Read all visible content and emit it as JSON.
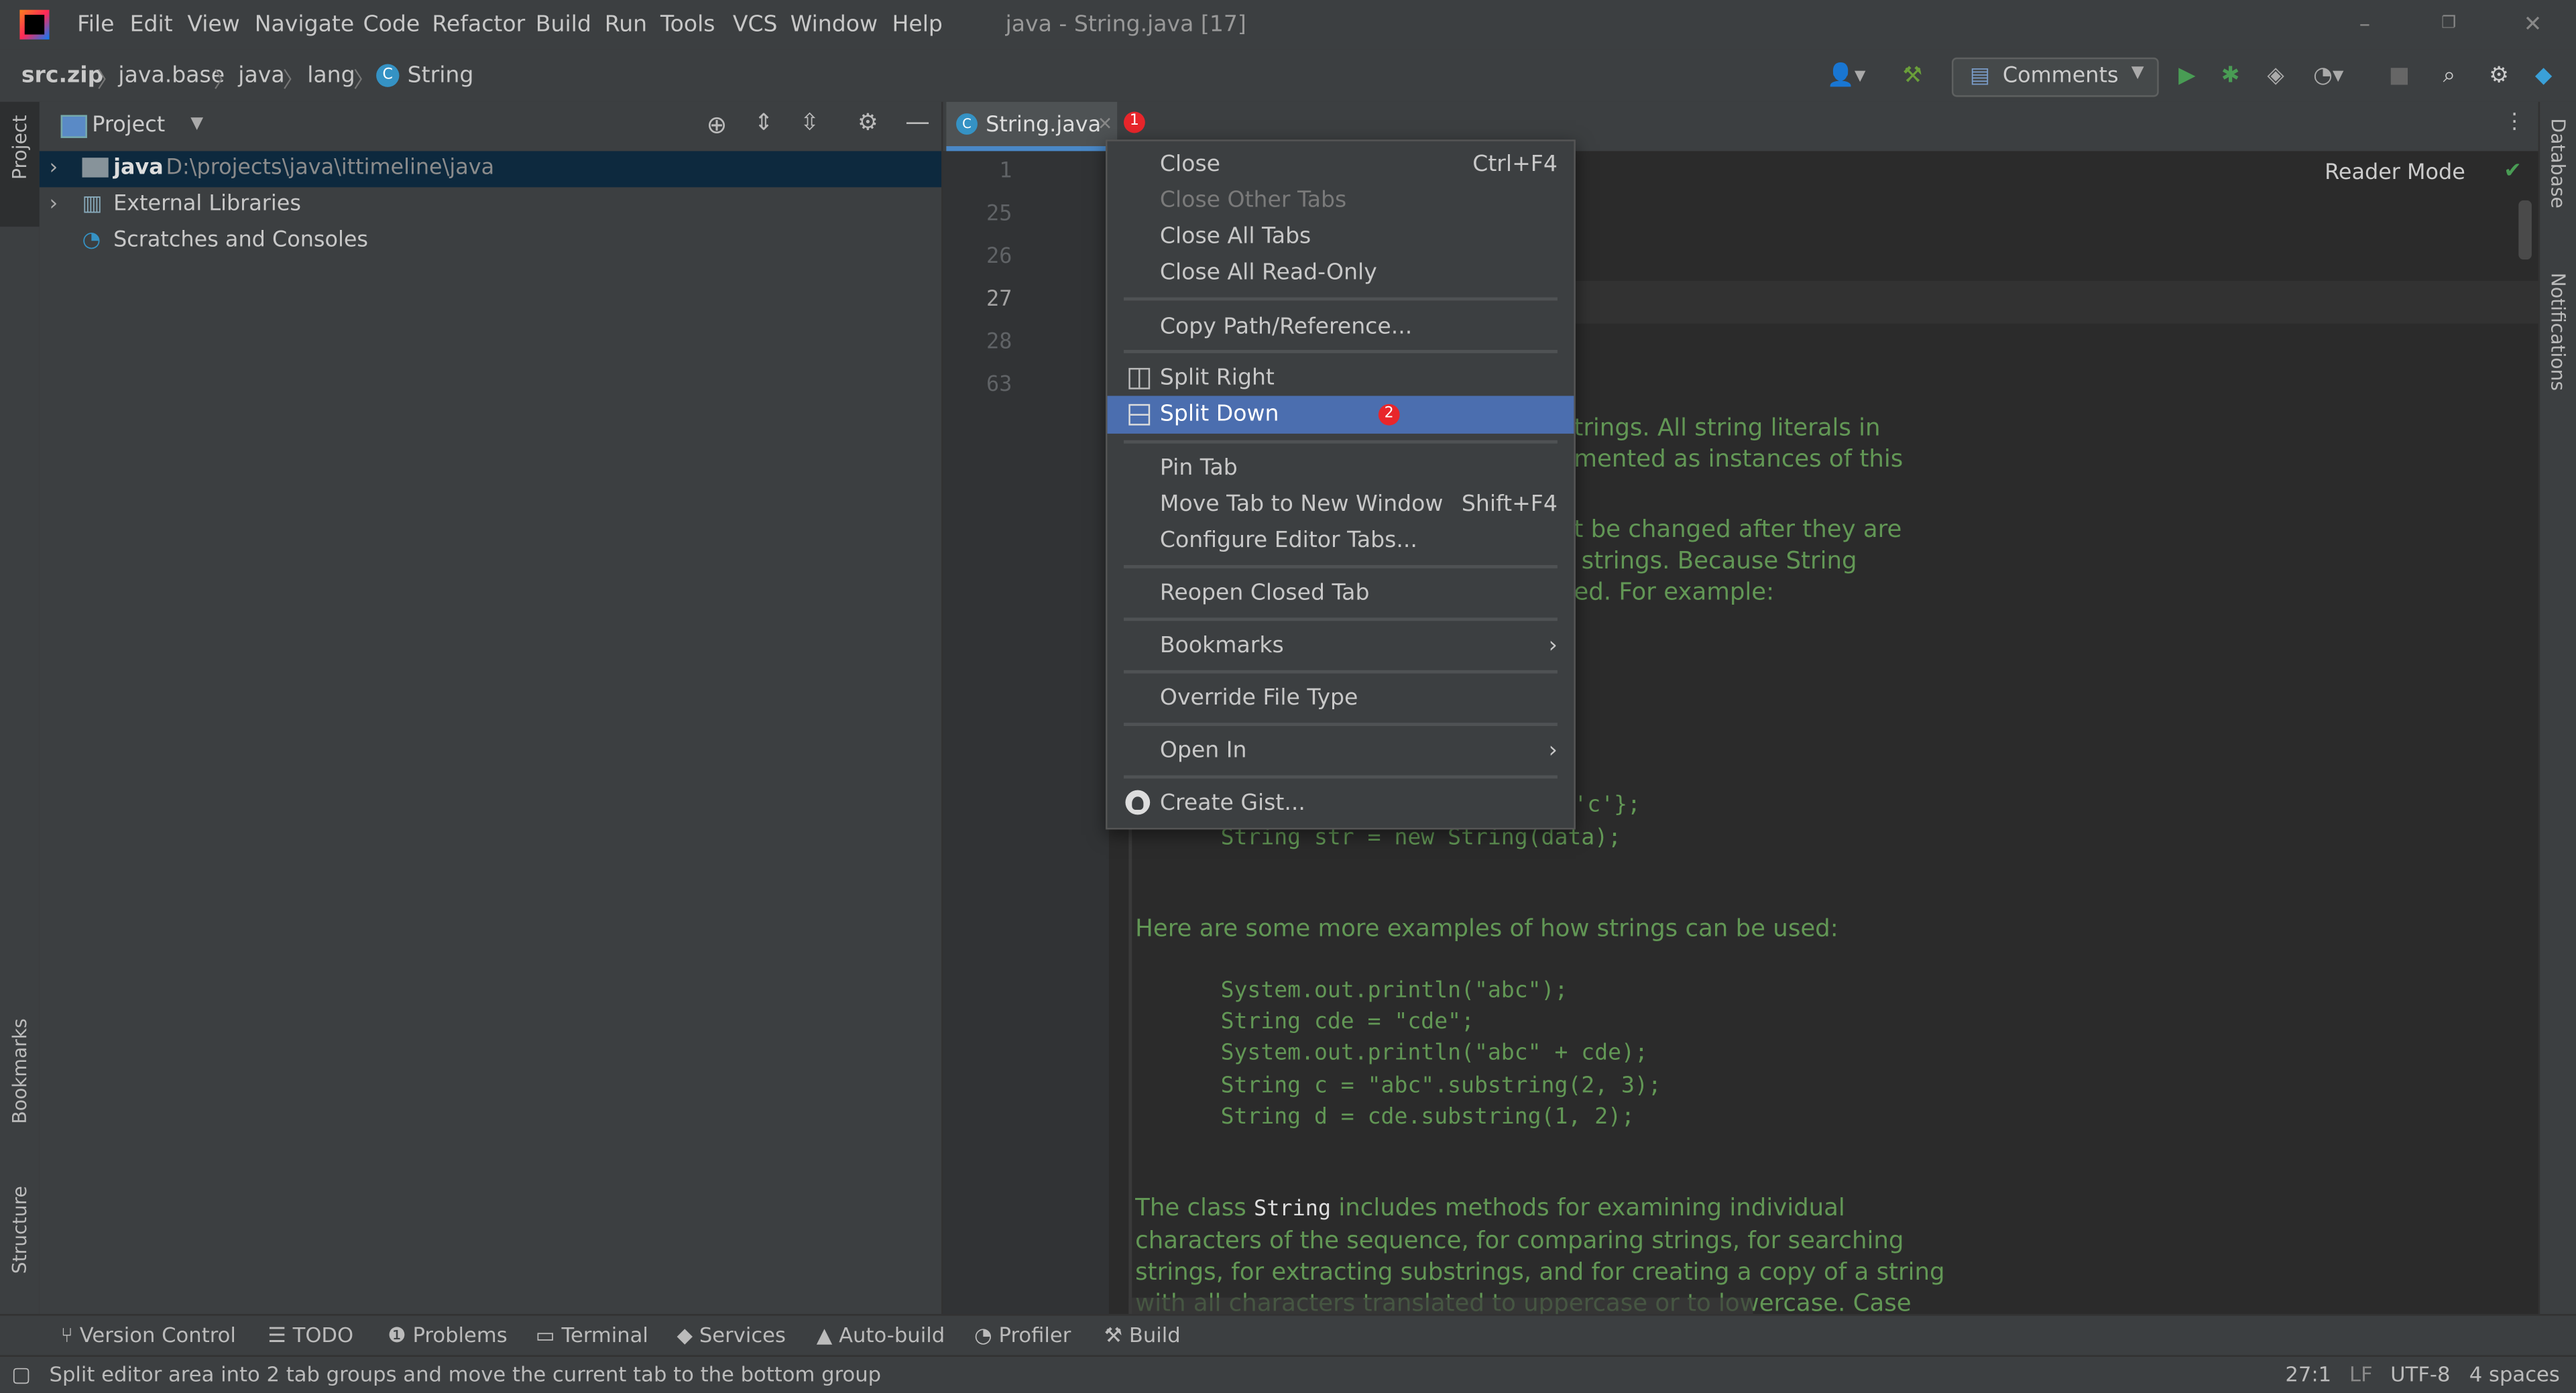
{
  "window": {
    "title": "java - String.java [17]",
    "menu": [
      "File",
      "Edit",
      "View",
      "Navigate",
      "Code",
      "Refactor",
      "Build",
      "Run",
      "Tools",
      "VCS",
      "Window",
      "Help"
    ]
  },
  "breadcrumb": [
    "src.zip",
    "java.base",
    "java",
    "lang",
    "String"
  ],
  "toolbar": {
    "run_config": "Comments"
  },
  "left_strip": {
    "project": "Project",
    "bookmarks": "Bookmarks",
    "structure": "Structure"
  },
  "right_strip": {
    "database": "Database",
    "notifications": "Notifications"
  },
  "project_panel": {
    "title": "Project",
    "tree": [
      {
        "name": "java",
        "path": "D:\\projects\\java\\ittimeline\\java"
      },
      {
        "name": "External Libraries"
      },
      {
        "name": "Scratches and Consoles"
      }
    ]
  },
  "editor": {
    "tab": "String.java",
    "tab_badge": "1",
    "reader_mode": "Reader Mode",
    "line_numbers": [
      "1",
      "25",
      "26",
      "27",
      "28",
      "63"
    ],
    "doc_fragments": [
      "trings. All string literals in",
      "mented as instances of this",
      "t be changed after they are",
      " strings. Because String",
      "ed. For example:"
    ],
    "code_fragment_1": "'c'};",
    "code_line_str": "String str = new String(data);",
    "examples_intro": "Here are some more examples of how strings can be used:",
    "examples": [
      "System.out.println(\"abc\");",
      "String cde = \"cde\";",
      "System.out.println(\"abc\" + cde);",
      "String c = \"abc\".substring(2, 3);",
      "String d = cde.substring(1, 2);"
    ],
    "para_start": "The class ",
    "para_code": "String",
    "para_rest": " includes methods for examining individual",
    "para_lines": [
      "characters of the sequence, for comparing strings, for searching",
      "strings, for extracting substrings, and for creating a copy of a string",
      "with all characters translated to uppercase or to lowercase. Case"
    ]
  },
  "context_menu": {
    "items": [
      {
        "label": "Close",
        "shortcut": "Ctrl+F4"
      },
      {
        "label": "Close Other Tabs",
        "disabled": true
      },
      {
        "label": "Close All Tabs"
      },
      {
        "label": "Close All Read-Only"
      },
      {
        "label": "Copy Path/Reference..."
      },
      {
        "label": "Split Right",
        "icon": "split-right-icon"
      },
      {
        "label": "Split Down",
        "icon": "split-down-icon",
        "selected": true,
        "badge": "2"
      },
      {
        "label": "Pin Tab"
      },
      {
        "label": "Move Tab to New Window",
        "shortcut": "Shift+F4"
      },
      {
        "label": "Configure Editor Tabs..."
      },
      {
        "label": "Reopen Closed Tab"
      },
      {
        "label": "Bookmarks",
        "submenu": true
      },
      {
        "label": "Override File Type"
      },
      {
        "label": "Open In",
        "submenu": true
      },
      {
        "label": "Create Gist...",
        "icon": "github-icon"
      }
    ]
  },
  "bottom_tools": [
    "Version Control",
    "TODO",
    "Problems",
    "Terminal",
    "Services",
    "Auto-build",
    "Profiler",
    "Build"
  ],
  "status": {
    "message": "Split editor area into 2 tab groups and move the current tab to the bottom group",
    "position": "27:1",
    "line_sep": "LF",
    "encoding": "UTF-8",
    "indent": "4 spaces"
  },
  "colors": {
    "accent": "#4b6eaf",
    "doc_green": "#629755",
    "badge_red": "#e8262b",
    "panel": "#3c3f41",
    "editor_bg": "#2b2b2b"
  }
}
